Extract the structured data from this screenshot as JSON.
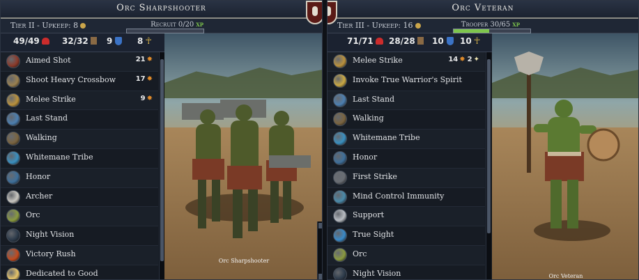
{
  "left_panel": {
    "title": "Orc Sharpshooter",
    "tier": "Tier II - Upkeep: 8",
    "rank": "Recruit 0/20",
    "xp_label": "xp",
    "xp_progress": 0.0,
    "stats": {
      "hp": "49/49",
      "moves": "32/32",
      "defense": "9",
      "resistance": "8"
    },
    "abilities": [
      {
        "label": "Aimed Shot",
        "value": "21",
        "icon": "aimed-shot-icon",
        "color": "#8a3a2a"
      },
      {
        "label": "Shoot Heavy Crossbow",
        "value": "17",
        "icon": "crossbow-icon",
        "color": "#9a8050"
      },
      {
        "label": "Melee Strike",
        "value": "9",
        "icon": "melee-strike-icon",
        "color": "#b9913d"
      },
      {
        "label": "Last Stand",
        "value": "",
        "icon": "last-stand-icon",
        "color": "#4c7fb0"
      },
      {
        "label": "Walking",
        "value": "",
        "icon": "walking-icon",
        "color": "#7a6440"
      },
      {
        "label": "Whitemane Tribe",
        "value": "",
        "icon": "whitemane-tribe-icon",
        "color": "#3a8fbf"
      },
      {
        "label": "Honor",
        "value": "",
        "icon": "honor-icon",
        "color": "#3e6f9a"
      },
      {
        "label": "Archer",
        "value": "",
        "icon": "archer-icon",
        "color": "#c8c6c0"
      },
      {
        "label": "Orc",
        "value": "",
        "icon": "orc-icon",
        "color": "#8a9a40"
      },
      {
        "label": "Night Vision",
        "value": "",
        "icon": "night-vision-icon",
        "color": "#2c3a4a"
      },
      {
        "label": "Victory Rush",
        "value": "",
        "icon": "victory-rush-icon",
        "color": "#c24a1e"
      },
      {
        "label": "Dedicated to Good",
        "value": "",
        "icon": "dedicated-to-good-icon",
        "color": "#e6c46a"
      }
    ],
    "caption": "Orc Sharpshooter"
  },
  "right_panel": {
    "title": "Orc Veteran",
    "tier": "Tier III - Upkeep: 16",
    "rank": "Trooper 30/65",
    "xp_label": "xp",
    "xp_progress": 0.46,
    "stats": {
      "hp": "71/71",
      "moves": "28/28",
      "defense": "10",
      "resistance": "10"
    },
    "abilities": [
      {
        "label": "Melee Strike",
        "value": "14",
        "extra": "2",
        "icon": "melee-strike-icon",
        "color": "#b9913d"
      },
      {
        "label": "Invoke True Warrior's Spirit",
        "value": "",
        "icon": "warrior-spirit-icon",
        "color": "#c9a844"
      },
      {
        "label": "Last Stand",
        "value": "",
        "icon": "last-stand-icon",
        "color": "#4c7fb0"
      },
      {
        "label": "Walking",
        "value": "",
        "icon": "walking-icon",
        "color": "#7a6440"
      },
      {
        "label": "Whitemane Tribe",
        "value": "",
        "icon": "whitemane-tribe-icon",
        "color": "#3a8fbf"
      },
      {
        "label": "Honor",
        "value": "",
        "icon": "honor-icon",
        "color": "#3e6f9a"
      },
      {
        "label": "First Strike",
        "value": "",
        "icon": "first-strike-icon",
        "color": "#6a6e74"
      },
      {
        "label": "Mind Control Immunity",
        "value": "",
        "icon": "mind-control-immunity-icon",
        "color": "#4a8aaa"
      },
      {
        "label": "Support",
        "value": "",
        "icon": "support-icon",
        "color": "#b8bcc2"
      },
      {
        "label": "True Sight",
        "value": "",
        "icon": "true-sight-icon",
        "color": "#3a8ac8"
      },
      {
        "label": "Orc",
        "value": "",
        "icon": "orc-icon",
        "color": "#8a9a40"
      },
      {
        "label": "Night Vision",
        "value": "",
        "icon": "night-vision-icon",
        "color": "#2c3a4a"
      }
    ],
    "caption": "Orc Veteran"
  }
}
